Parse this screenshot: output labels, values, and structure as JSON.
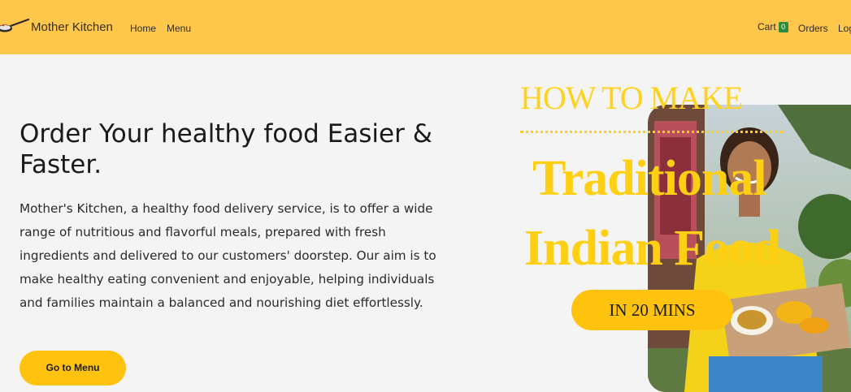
{
  "navbar": {
    "brand": "Mother Kitchen",
    "links": {
      "home": "Home",
      "menu": "Menu",
      "orders": "Orders",
      "logout": "Logout"
    },
    "cart": {
      "label": "Cart",
      "count": "0"
    }
  },
  "hero": {
    "title": "Order Your healthy food Easier & Faster.",
    "description": "Mother's Kitchen, a healthy food delivery service, is to offer a wide range of nutritious and flavorful meals, prepared with fresh ingredients and delivered to our customers' doorstep. Our aim is to make healthy eating convenient and enjoyable, helping individuals and families maintain a balanced and nourishing diet effortlessly.",
    "cta": "Go to Menu"
  },
  "promo": {
    "line1": "HOW TO MAKE",
    "line2": "Traditional",
    "line3": "Indian Food",
    "pill": "IN 20 MINS"
  },
  "colors": {
    "navbar_bg": "#ffc84d",
    "accent": "#ffc20e",
    "badge": "#2e8b3e",
    "promo_text": "#ffcf14"
  },
  "icons": {
    "brand": "pan-logo-icon"
  }
}
